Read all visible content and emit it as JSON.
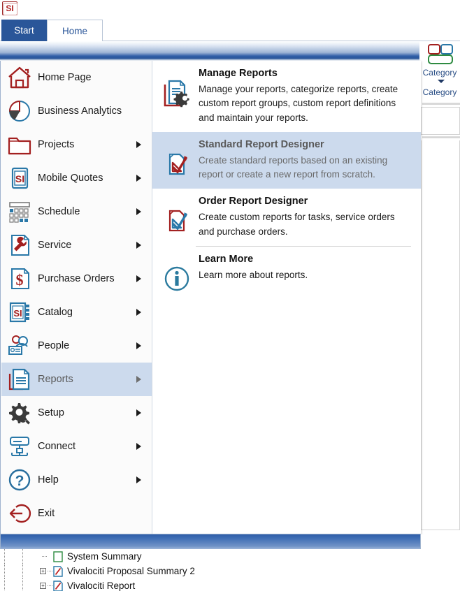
{
  "app": {
    "logo": "si-logo",
    "logo_text": "SI"
  },
  "tabs": [
    {
      "label": "Start",
      "active": true,
      "name": "tab-start"
    },
    {
      "label": "Home",
      "active": false,
      "name": "tab-home"
    }
  ],
  "ribbon": {
    "category_group": {
      "icon": "category-layout-icon",
      "button_label": "Category",
      "dropdown_label": "Category",
      "caret": "chevron-down-icon"
    }
  },
  "sidebar": {
    "items": [
      {
        "label": "Home Page",
        "icon": "home-icon",
        "has_submenu": false,
        "selected": false
      },
      {
        "label": "Business Analytics",
        "icon": "pie-chart-icon",
        "has_submenu": false,
        "selected": false
      },
      {
        "label": "Projects",
        "icon": "folder-icon",
        "has_submenu": true,
        "selected": false
      },
      {
        "label": "Mobile Quotes",
        "icon": "si-tablet-icon",
        "has_submenu": true,
        "selected": false
      },
      {
        "label": "Schedule",
        "icon": "calendar-grid-icon",
        "has_submenu": true,
        "selected": false
      },
      {
        "label": "Service",
        "icon": "wrench-document-icon",
        "has_submenu": true,
        "selected": false
      },
      {
        "label": "Purchase Orders",
        "icon": "dollar-document-icon",
        "has_submenu": true,
        "selected": false
      },
      {
        "label": "Catalog",
        "icon": "si-binder-icon",
        "has_submenu": true,
        "selected": false
      },
      {
        "label": "People",
        "icon": "people-badge-icon",
        "has_submenu": true,
        "selected": false
      },
      {
        "label": "Reports",
        "icon": "documents-icon",
        "has_submenu": true,
        "selected": true
      },
      {
        "label": "Setup",
        "icon": "gear-wrench-icon",
        "has_submenu": true,
        "selected": false
      },
      {
        "label": "Connect",
        "icon": "network-icon",
        "has_submenu": true,
        "selected": false
      },
      {
        "label": "Help",
        "icon": "question-circle-icon",
        "has_submenu": true,
        "selected": false
      },
      {
        "label": "Exit",
        "icon": "exit-arrow-icon",
        "has_submenu": false,
        "selected": false
      }
    ]
  },
  "panel": {
    "entries": [
      {
        "title": "Manage Reports",
        "description": "Manage your reports, categorize reports, create custom report groups, custom report definitions and maintain your reports.",
        "icon": "report-gear-icon",
        "highlight": false,
        "separator_after": false
      },
      {
        "title": "Standard Report Designer",
        "description": "Create standard reports based on an existing report or create a new report from scratch.",
        "icon": "report-pen-icon",
        "highlight": true,
        "separator_after": false
      },
      {
        "title": "Order Report Designer",
        "description": "Create custom reports for tasks, service orders and purchase orders.",
        "icon": "report-pen-icon",
        "highlight": false,
        "separator_after": true
      },
      {
        "title": "Learn More",
        "description": "Learn more about reports.",
        "icon": "info-circle-icon",
        "highlight": false,
        "separator_after": false
      }
    ]
  },
  "background_tree": {
    "rows": [
      {
        "label": "System Summary",
        "icon": "report-node-icon",
        "expandable": false,
        "indent": 3
      },
      {
        "label": "Vivalociti Proposal Summary 2",
        "icon": "report-node-icon",
        "expandable": true,
        "indent": 3
      },
      {
        "label": "Vivalociti Report",
        "icon": "report-node-icon",
        "expandable": true,
        "indent": 3
      }
    ]
  },
  "colors": {
    "accent_blue": "#2a5699",
    "selection_blue": "#ccdaed",
    "brand_red": "#b02020",
    "icon_blue": "#2a78a8",
    "icon_green": "#2e8b41"
  }
}
